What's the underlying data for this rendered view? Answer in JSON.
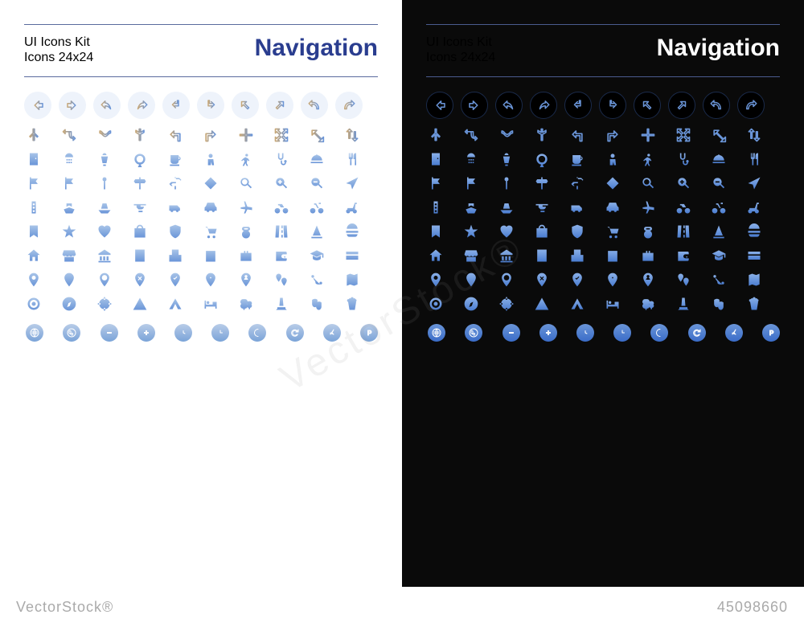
{
  "header": {
    "title_main": "UI Icons Kit",
    "title_sub": "Icons 24x24",
    "category": "Navigation"
  },
  "footer": {
    "brand": "VectorStock®",
    "id": "45098660"
  },
  "watermark": "VectorStock®",
  "arrow_icons": [
    "arrow-left",
    "arrow-right",
    "undo",
    "redo",
    "turn-left",
    "turn-right",
    "up-left",
    "up-right",
    "curve-left",
    "curve-right"
  ],
  "nav_row2": [
    "merge",
    "route",
    "s-curve",
    "fork-right",
    "turn-up-left",
    "turn-up-right",
    "cross",
    "expand",
    "diagonal",
    "swap-vert"
  ],
  "poi_row3": [
    "door",
    "shower",
    "fountain",
    "ferris-wheel",
    "coffee",
    "person",
    "walk",
    "stethoscope",
    "serving",
    "cutlery"
  ],
  "poi_row4": [
    "flag",
    "flag-outline",
    "pin",
    "signpost",
    "directions",
    "diamond",
    "search",
    "zoom-in",
    "zoom-out",
    "navigate"
  ],
  "transport_row5": [
    "traffic-light",
    "ship",
    "boat",
    "helicopter",
    "van",
    "car",
    "plane",
    "motorcycle",
    "bicycle",
    "scooter"
  ],
  "poi_row6": [
    "bookmark",
    "star",
    "heart",
    "bag",
    "shield",
    "cart",
    "kettlebell",
    "road",
    "cone",
    "burger"
  ],
  "building_row7": [
    "home",
    "storefront",
    "bank",
    "office",
    "building",
    "calendar",
    "briefcase",
    "wallet",
    "graduation",
    "card"
  ],
  "pin_row8": [
    "pin-drop",
    "pin-solid",
    "pin-outline",
    "pin-x",
    "pin-check",
    "pin-dot",
    "pin-person",
    "pins",
    "route-map",
    "map"
  ],
  "misc_row9": [
    "target",
    "compass",
    "crosshair",
    "warning",
    "tent",
    "bed",
    "trees",
    "monument",
    "masks",
    "popcorn"
  ],
  "disc_row10": [
    "globe",
    "earth",
    "remove",
    "add",
    "clock",
    "time",
    "moon",
    "refresh",
    "navigate-disc",
    "parking"
  ]
}
